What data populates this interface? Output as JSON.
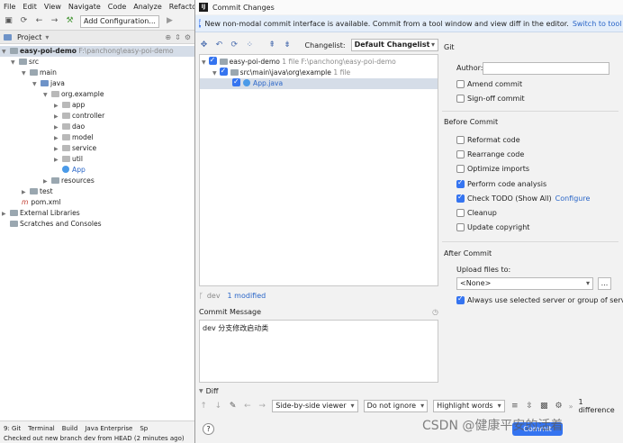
{
  "ide": {
    "menu": [
      "File",
      "Edit",
      "View",
      "Navigate",
      "Code",
      "Analyze",
      "Refactor"
    ],
    "config_button": "Add Configuration...",
    "project_panel_title": "Project",
    "tree": [
      {
        "label": "easy-poi-demo",
        "extra": "F:\\panchong\\easy-poi-demo"
      },
      {
        "label": "src"
      },
      {
        "label": "main"
      },
      {
        "label": "java"
      },
      {
        "label": "org.example"
      },
      {
        "label": "app"
      },
      {
        "label": "controller"
      },
      {
        "label": "dao"
      },
      {
        "label": "model"
      },
      {
        "label": "service"
      },
      {
        "label": "util"
      },
      {
        "label": "App"
      },
      {
        "label": "resources"
      },
      {
        "label": "test"
      },
      {
        "label": "pom.xml"
      },
      {
        "label": "External Libraries"
      },
      {
        "label": "Scratches and Consoles"
      }
    ],
    "bottom_tabs": [
      "9: Git",
      "Terminal",
      "Build",
      "Java Enterprise",
      "Sp"
    ],
    "status": "Checked out new branch dev from HEAD (2 minutes ago)"
  },
  "dialog": {
    "title": "Commit Changes",
    "notice": "New non-modal commit interface is available. Commit from a tool window and view diff in the editor.",
    "notice_link": "Switch to tool window",
    "changelist_label": "Changelist:",
    "changelist_value": "Default Changelist",
    "changes": [
      {
        "label": "easy-poi-demo",
        "extra": "1 file  F:\\panchong\\easy-poi-demo"
      },
      {
        "label": "src\\main\\java\\org\\example",
        "extra": "1 file"
      },
      {
        "label": "App.java",
        "extra": ""
      }
    ],
    "branch": "dev",
    "modified": "1 modified",
    "commit_message_label": "Commit Message",
    "commit_message": "dev 分支修改启动类",
    "git_section": "Git",
    "author_label": "Author:",
    "author_value": "",
    "amend": "Amend commit",
    "signoff": "Sign-off commit",
    "before_commit": "Before Commit",
    "before_options": [
      {
        "label": "Reformat code",
        "checked": false
      },
      {
        "label": "Rearrange code",
        "checked": false
      },
      {
        "label": "Optimize imports",
        "checked": false
      },
      {
        "label": "Perform code analysis",
        "checked": true
      },
      {
        "label": "Check TODO (Show All)",
        "checked": true
      },
      {
        "label": "Cleanup",
        "checked": false
      },
      {
        "label": "Update copyright",
        "checked": false
      }
    ],
    "configure_link": "Configure",
    "after_commit": "After Commit",
    "upload_label": "Upload files to:",
    "upload_value": "<None>",
    "browse": "...",
    "always_use": "Always use selected server or group of servers",
    "diff_label": "Diff",
    "viewer": "Side-by-side viewer",
    "ignore": "Do not ignore",
    "highlight": "Highlight words",
    "difference": "1 difference",
    "help": "?",
    "commit_button": "Commit"
  },
  "watermark": "CSDN @健康平安的活着"
}
